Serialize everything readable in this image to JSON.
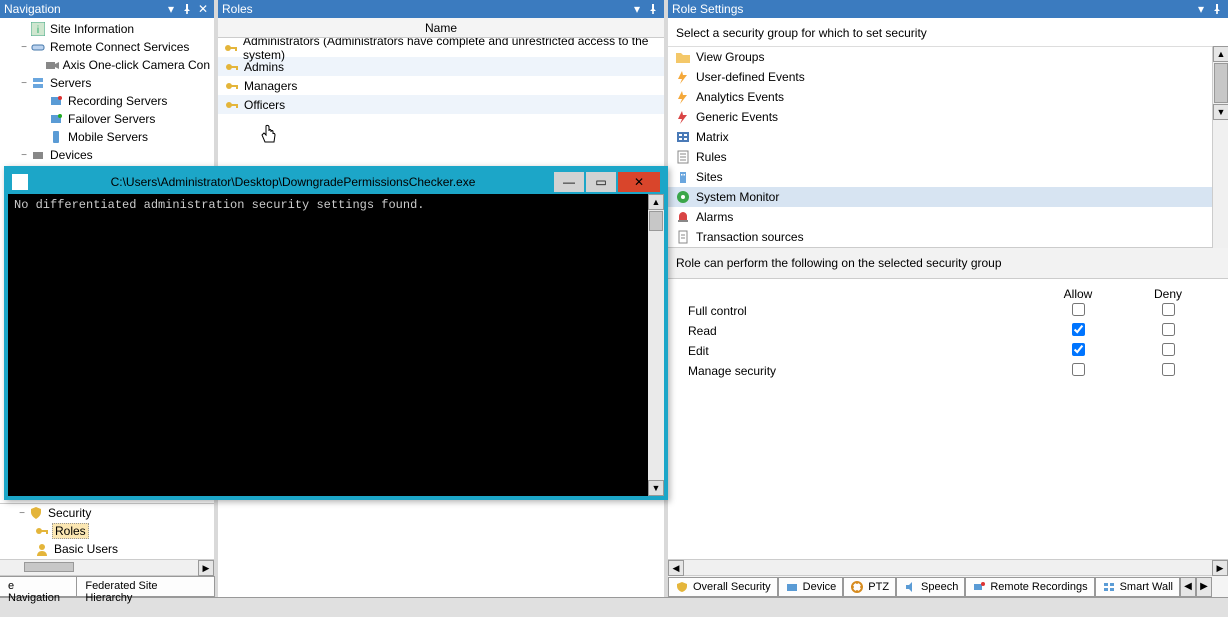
{
  "nav": {
    "title": "Navigation",
    "items": [
      {
        "label": "Site Information",
        "icon": "info",
        "indent": 1,
        "expander": ""
      },
      {
        "label": "Remote Connect Services",
        "icon": "link",
        "indent": 1,
        "expander": "−"
      },
      {
        "label": "Axis One-click Camera Con",
        "icon": "camera",
        "indent": 2,
        "expander": ""
      },
      {
        "label": "Servers",
        "icon": "server",
        "indent": 1,
        "expander": "−"
      },
      {
        "label": "Recording Servers",
        "icon": "rec",
        "indent": 2,
        "expander": ""
      },
      {
        "label": "Failover Servers",
        "icon": "failover",
        "indent": 2,
        "expander": ""
      },
      {
        "label": "Mobile Servers",
        "icon": "mobile",
        "indent": 2,
        "expander": ""
      },
      {
        "label": "Devices",
        "icon": "device",
        "indent": 1,
        "expander": "−"
      }
    ],
    "security": {
      "header": "Security",
      "roles": "Roles",
      "basic": "Basic Users"
    },
    "tabs": [
      "e Navigation",
      "Federated Site Hierarchy"
    ]
  },
  "roles": {
    "title": "Roles",
    "column": "Name",
    "items": [
      "Administrators (Administrators have complete and unrestricted access to the system)",
      "Admins",
      "Managers",
      "Officers"
    ]
  },
  "settings": {
    "title": "Role Settings",
    "instruction": "Select a security group for which to set security",
    "groups": [
      {
        "label": "View Groups",
        "icon": "folder"
      },
      {
        "label": "User-defined Events",
        "icon": "flash-orange"
      },
      {
        "label": "Analytics Events",
        "icon": "flash-orange"
      },
      {
        "label": "Generic Events",
        "icon": "flash-red"
      },
      {
        "label": "Matrix",
        "icon": "matrix"
      },
      {
        "label": "Rules",
        "icon": "rules"
      },
      {
        "label": "Sites",
        "icon": "sites"
      },
      {
        "label": "System Monitor",
        "icon": "monitor",
        "selected": true
      },
      {
        "label": "Alarms",
        "icon": "alarm"
      },
      {
        "label": "Transaction sources",
        "icon": "doc"
      }
    ],
    "perm_instruction": "Role can perform the following on the selected security group",
    "perm_head_allow": "Allow",
    "perm_head_deny": "Deny",
    "perms": [
      {
        "label": "Full control",
        "allow": false,
        "deny": false
      },
      {
        "label": "Read",
        "allow": true,
        "deny": false
      },
      {
        "label": "Edit",
        "allow": true,
        "deny": false
      },
      {
        "label": "Manage security",
        "allow": false,
        "deny": false
      }
    ],
    "tabs": [
      "Overall Security",
      "Device",
      "PTZ",
      "Speech",
      "Remote Recordings",
      "Smart Wall"
    ]
  },
  "console": {
    "path": "C:\\Users\\Administrator\\Desktop\\DowngradePermissionsChecker.exe",
    "output": "No differentiated administration security settings found."
  }
}
